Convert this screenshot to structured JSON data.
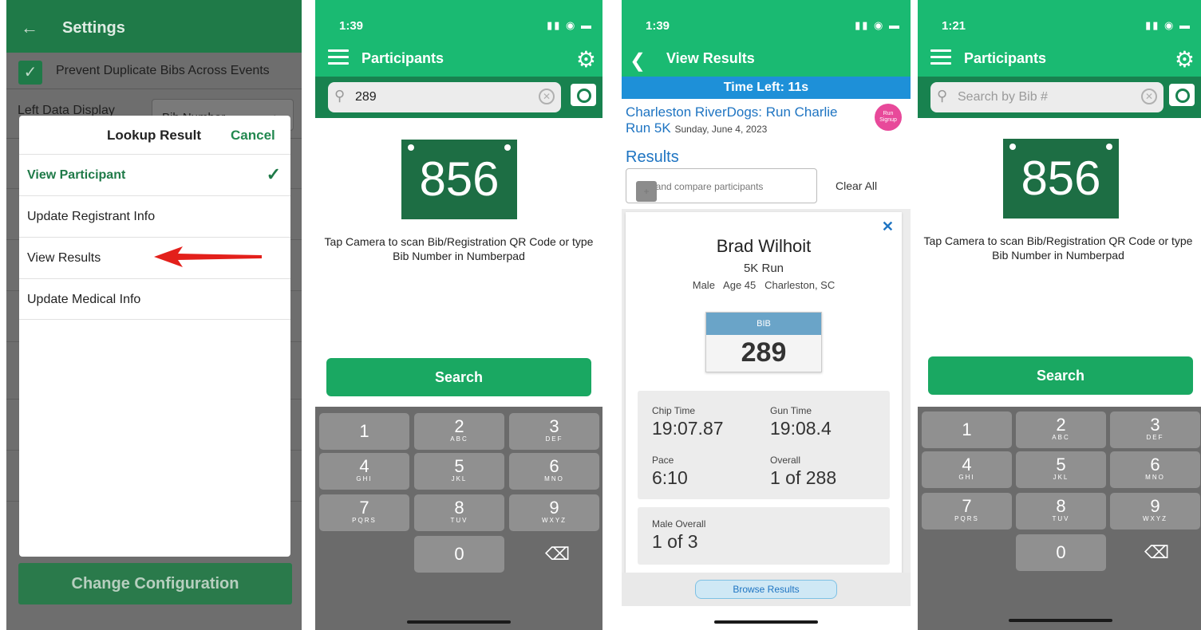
{
  "screen1": {
    "title": "Settings",
    "prevent_label": "Prevent Duplicate Bibs Across Events",
    "left_data_label": "Left Data Display",
    "left_data_value": "Bib Number",
    "modal": {
      "title": "Lookup Result",
      "cancel": "Cancel",
      "items": [
        "View Participant",
        "Update Registrant Info",
        "View Results",
        "Update Medical Info"
      ]
    },
    "change_button": "Change Configuration"
  },
  "screen2": {
    "time": "1:39",
    "title": "Participants",
    "search_value": "289",
    "bib": "856",
    "hint": "Tap Camera to scan Bib/Registration QR Code or type Bib Number in Numberpad",
    "search_button": "Search"
  },
  "screen3": {
    "time": "1:39",
    "title": "View Results",
    "time_left": "Time Left: 11s",
    "race_name": "Charleston RiverDogs: Run Charlie Run 5K",
    "race_date": "Sunday, June 4, 2023",
    "logo_text": "Run Signup",
    "results_heading": "Results",
    "compare_placeholder": "Add and compare participants",
    "clear_all": "Clear All",
    "participant": {
      "name": "Brad Wilhoit",
      "event": "5K Run",
      "info": "Male   Age 45   Charleston, SC",
      "bib_label": "BIB",
      "bib": "289"
    },
    "stats": {
      "chip_time_label": "Chip Time",
      "chip_time": "19:07.87",
      "gun_time_label": "Gun Time",
      "gun_time": "19:08.4",
      "pace_label": "Pace",
      "pace": "6:10",
      "overall_label": "Overall",
      "overall": "1 of 288",
      "male_overall_label": "Male Overall",
      "male_overall": "1 of 3"
    },
    "browse_button": "Browse Results"
  },
  "screen4": {
    "time": "1:21",
    "title": "Participants",
    "search_placeholder": "Search by Bib #",
    "bib": "856",
    "hint": "Tap Camera to scan Bib/Registration QR Code or type Bib Number in Numberpad",
    "search_button": "Search"
  },
  "keypad": [
    {
      "d": "1",
      "l": ""
    },
    {
      "d": "2",
      "l": "ABC"
    },
    {
      "d": "3",
      "l": "DEF"
    },
    {
      "d": "4",
      "l": "GHI"
    },
    {
      "d": "5",
      "l": "JKL"
    },
    {
      "d": "6",
      "l": "MNO"
    },
    {
      "d": "7",
      "l": "PQRS"
    },
    {
      "d": "8",
      "l": "TUV"
    },
    {
      "d": "9",
      "l": "WXYZ"
    },
    {
      "d": "0",
      "l": ""
    }
  ],
  "colors": {
    "green": "#1aba72",
    "dark_green": "#1d6e44",
    "blue": "#1e90d8",
    "arrow": "#e3201b"
  }
}
